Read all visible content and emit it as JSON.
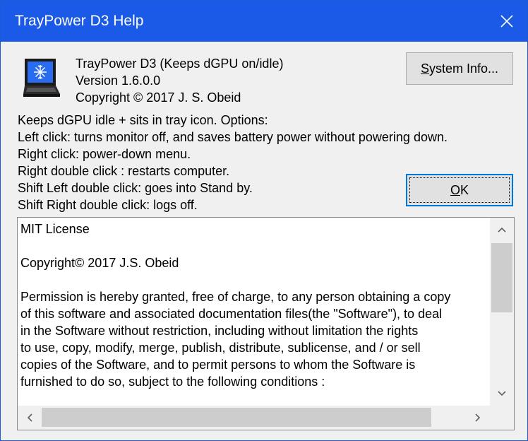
{
  "window": {
    "title": "TrayPower D3 Help",
    "titlebar_color": "#1a5ae6"
  },
  "about": {
    "product": "TrayPower D3 (Keeps dGPU on/idle)",
    "version": "Version 1.6.0.0",
    "copyright": "Copyright © 2017  J. S. Obeid",
    "icon": "laptop-snowflake-icon"
  },
  "description": [
    "Keeps dGPU idle + sits in tray icon. Options:",
    "Left click: turns monitor off, and saves battery power without powering down.",
    "Right click: power-down menu.",
    "Right double click : restarts computer.",
    "Shift Left double click: goes into Stand by.",
    "Shift Right double click: logs off."
  ],
  "buttons": {
    "system_info": {
      "accel": "S",
      "rest": "ystem Info..."
    },
    "ok": {
      "accel": "O",
      "rest": "K"
    }
  },
  "license": {
    "heading": "MIT License",
    "copyright": "Copyright© 2017 J.S. Obeid",
    "body": [
      "Permission is hereby granted, free of charge, to any person obtaining a copy",
      "of this software and associated documentation files(the \"Software\"), to deal",
      "in the Software without restriction, including without limitation the rights",
      "to use, copy, modify, merge, publish, distribute, sublicense, and / or sell",
      "copies of the Software, and to permit persons to whom the Software is",
      "furnished to do so, subject to the following conditions :"
    ]
  }
}
